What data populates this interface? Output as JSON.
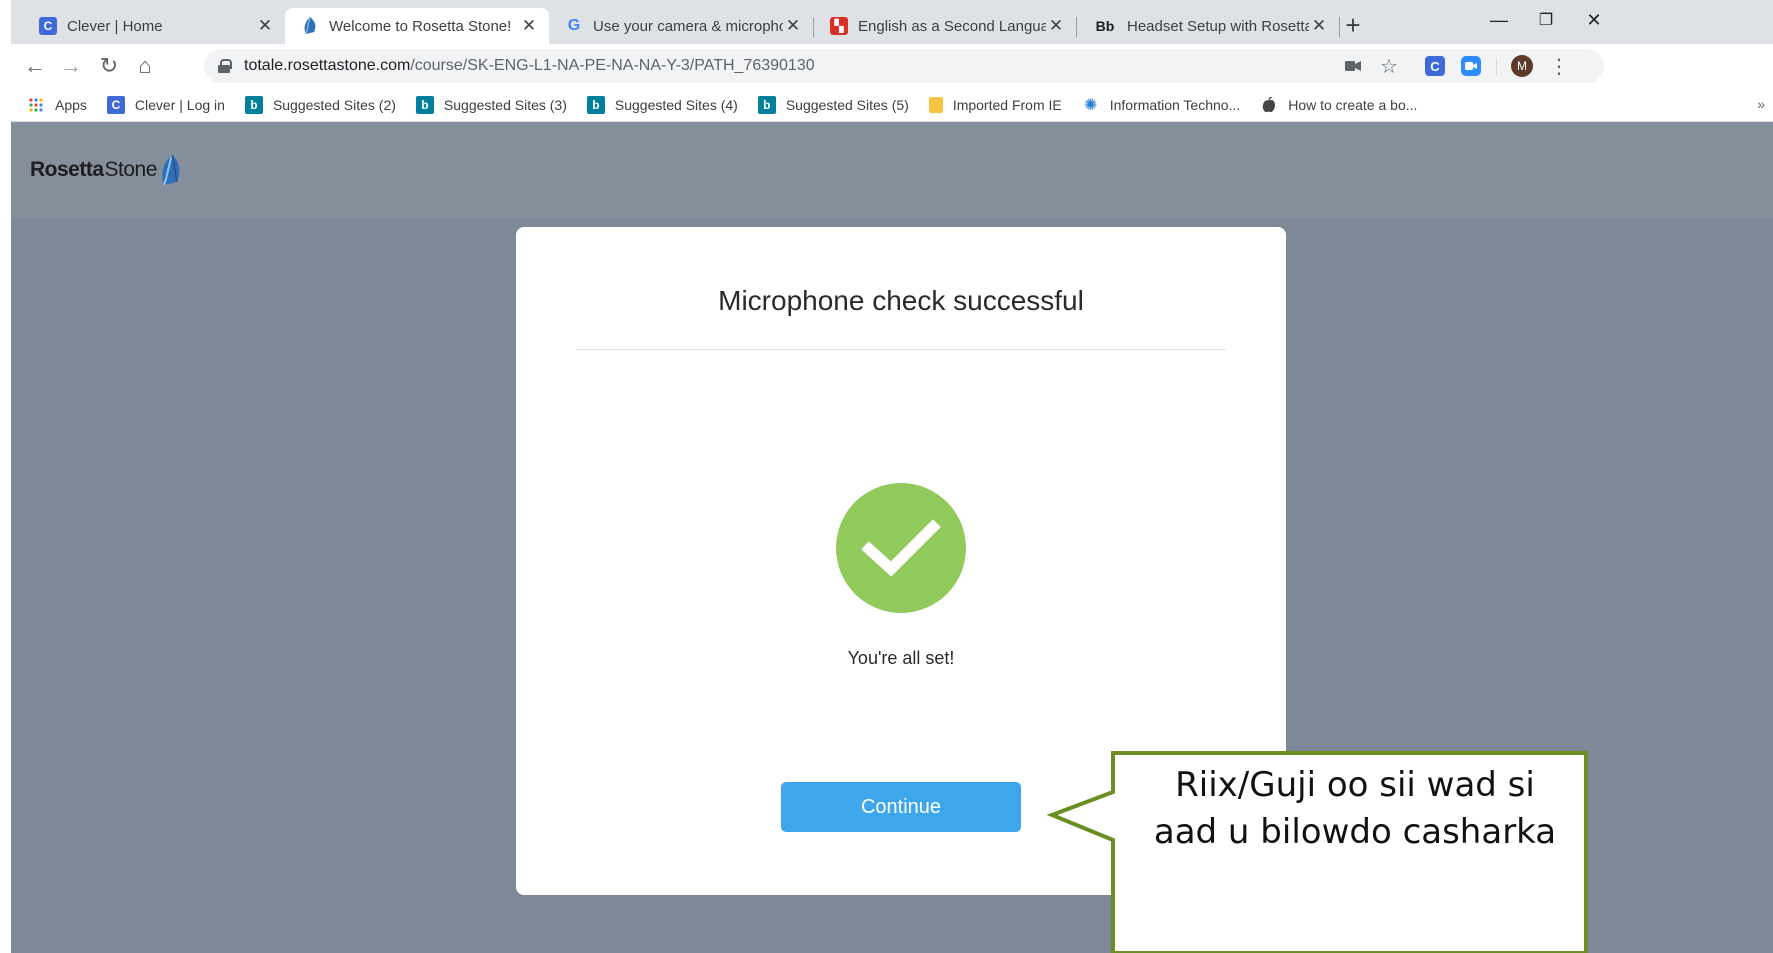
{
  "browser": {
    "tabs": [
      {
        "title": "Clever | Home",
        "favicon": "clever-favicon",
        "favicon_letter": "C",
        "color": "#3f6ad8",
        "active": false
      },
      {
        "title": "Welcome to Rosetta Stone!",
        "favicon": "rosetta-stone-favicon",
        "color": "#2f6fb8",
        "active": true
      },
      {
        "title": "Use your camera & micropho",
        "favicon": "google-favicon",
        "favicon_letter": "G",
        "color": "#4285f4",
        "active": false
      },
      {
        "title": "English as a Second Language",
        "favicon": "red-flag-favicon",
        "color": "#d93025",
        "active": false
      },
      {
        "title": "Headset Setup with Rosetta St",
        "favicon": "blackboard-favicon",
        "favicon_letter": "Bb",
        "color": "#1d1d1d",
        "active": false
      }
    ],
    "url_host": "totale.rosettastone.com",
    "url_path": "/course/SK-ENG-L1-NA-PE-NA-NA-Y-3/PATH_76390130",
    "profile_initial": "M",
    "bookmarks": [
      {
        "label": "Apps",
        "icon": "apps-grid-icon"
      },
      {
        "label": "Clever | Log in",
        "icon": "clever-favicon",
        "letter": "C",
        "color": "#3f6ad8"
      },
      {
        "label": "Suggested Sites (2)",
        "icon": "bing-favicon",
        "letter": "b",
        "color": "#00809d"
      },
      {
        "label": "Suggested Sites (3)",
        "icon": "bing-favicon",
        "letter": "b",
        "color": "#00809d"
      },
      {
        "label": "Suggested Sites (4)",
        "icon": "bing-favicon",
        "letter": "b",
        "color": "#00809d"
      },
      {
        "label": "Suggested Sites (5)",
        "icon": "bing-favicon",
        "letter": "b",
        "color": "#00809d"
      },
      {
        "label": "Imported From IE",
        "icon": "folder-icon",
        "color": "#f6c344"
      },
      {
        "label": "Information Techno...",
        "icon": "it-favicon",
        "color": "#2a7fd4"
      },
      {
        "label": "How to create a bo...",
        "icon": "apple-icon",
        "color": "#444444"
      }
    ],
    "bookmarks_more": "»"
  },
  "site": {
    "logo_bold": "Rosetta",
    "logo_light": "Stone",
    "logo_icon": "rosetta-stone-logo-icon"
  },
  "modal": {
    "title": "Microphone check successful",
    "message": "You're all set!",
    "continue_label": "Continue",
    "status_icon": "checkmark-icon",
    "success_color": "#8fca5b",
    "button_color": "#3ea6eb"
  },
  "callout": {
    "line1": "Riix/Guji oo sii wad si",
    "line2": "aad u bilowdo casharka",
    "border_color": "#6b8e23"
  }
}
